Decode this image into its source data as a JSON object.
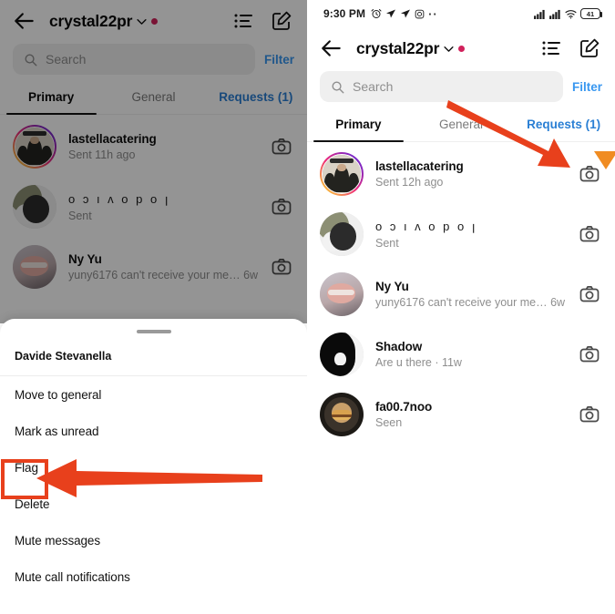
{
  "meta": {
    "accent_red": "#e8401c",
    "accent_orange": "#f08c22",
    "instagram_blue": "#3897f0",
    "unread_pink": "#d1215b"
  },
  "status_bar": {
    "time": "9:30 PM",
    "icons": [
      "alarm-icon",
      "send-icon",
      "send-icon",
      "instagram-icon"
    ],
    "more_dots": "··",
    "signal_1": "signal-bars-icon",
    "signal_2": "signal-bars-icon",
    "wifi": "wifi-icon",
    "battery_level": "41"
  },
  "header": {
    "back_icon": "back-arrow-icon",
    "account_name": "crystal22pr",
    "chevron_icon": "chevron-down-icon",
    "unread_dot": "unread-dot",
    "threads_icon": "threads-list-icon",
    "compose_icon": "compose-edit-icon"
  },
  "search": {
    "icon": "search-icon",
    "placeholder": "Search",
    "value": "",
    "filter_label": "Filter"
  },
  "tabs": [
    {
      "label": "Primary",
      "active": true
    },
    {
      "label": "General",
      "active": false
    },
    {
      "label": "Requests (1)",
      "active": false
    }
  ],
  "chats_left": [
    {
      "name": "lastellacatering",
      "preview": "Sent 11h ago",
      "avatar": "a1",
      "ring": true,
      "camera": "camera-icon"
    },
    {
      "name": "o ɔ ı ʌ o p o ꞁ",
      "preview": "Sent",
      "avatar": "a2",
      "ring": false,
      "camera": "camera-icon"
    },
    {
      "name": "Ny Yu",
      "preview": "yuny6176 can't receive your me… 6w",
      "avatar": "a3",
      "ring": false,
      "camera": "camera-icon"
    }
  ],
  "chats_right": [
    {
      "name": "lastellacatering",
      "preview": "Sent 12h ago",
      "avatar": "a1",
      "ring": true,
      "camera": "camera-icon"
    },
    {
      "name": "o ɔ ı ʌ o p o ꞁ",
      "preview": "Sent",
      "avatar": "a2",
      "ring": false,
      "camera": "camera-icon"
    },
    {
      "name": "Ny Yu",
      "preview": "yuny6176 can't receive your me… 6w",
      "avatar": "a3",
      "ring": false,
      "camera": "camera-icon"
    },
    {
      "name": "Shadow",
      "preview": "Are u there · 11w",
      "avatar": "a4",
      "ring": false,
      "camera": "camera-icon"
    },
    {
      "name": "fa00.7noo",
      "preview": "Seen",
      "avatar": "a5",
      "ring": false,
      "camera": "camera-icon"
    }
  ],
  "sheet": {
    "handle": "drag-handle",
    "user_name": "Davide Stevanella",
    "items": [
      {
        "label": "Move to general"
      },
      {
        "label": "Mark as unread"
      },
      {
        "label": "Flag"
      },
      {
        "label": "Delete"
      },
      {
        "label": "Mute messages"
      },
      {
        "label": "Mute call notifications"
      }
    ]
  },
  "annotations": {
    "left_arrow": "red-arrow-pointing-left-at-flag",
    "right_arrow": "red-arrow-pointing-at-camera-icon",
    "corner_marker": "orange-triangle-marker",
    "flag_highlight": "red-highlight-box-around-flag"
  }
}
